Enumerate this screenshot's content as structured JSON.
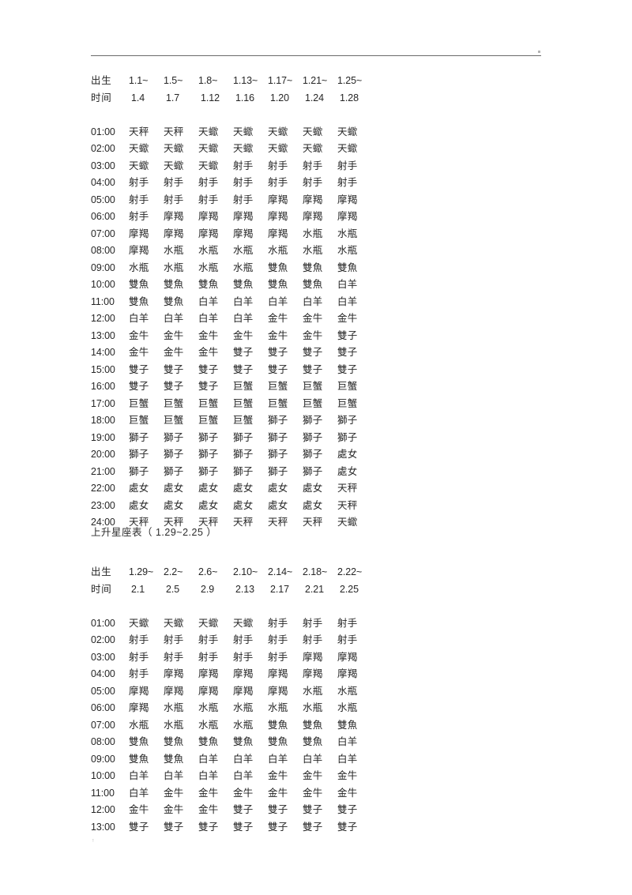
{
  "document": {
    "header_rule": true,
    "footer_mark": "፧"
  },
  "section1": {
    "date_label_start": "出生",
    "date_label_end": "时间",
    "dates_start": [
      "1.1~",
      "1.5~",
      "1.8~",
      "1.13~",
      "1.17~",
      "1.21~",
      "1.25~"
    ],
    "dates_end": [
      "1.4",
      "1.7",
      "1.12",
      "1.16",
      "1.20",
      "1.24",
      "1.28"
    ],
    "rows": [
      {
        "time": "01:00",
        "signs": [
          "天秤",
          "天秤",
          "天蠍",
          "天蠍",
          "天蠍",
          "天蠍",
          "天蠍"
        ]
      },
      {
        "time": "02:00",
        "signs": [
          "天蠍",
          "天蠍",
          "天蠍",
          "天蠍",
          "天蠍",
          "天蠍",
          "天蠍"
        ]
      },
      {
        "time": "03:00",
        "signs": [
          "天蠍",
          "天蠍",
          "天蠍",
          "射手",
          "射手",
          "射手",
          "射手"
        ]
      },
      {
        "time": "04:00",
        "signs": [
          "射手",
          "射手",
          "射手",
          "射手",
          "射手",
          "射手",
          "射手"
        ]
      },
      {
        "time": "05:00",
        "signs": [
          "射手",
          "射手",
          "射手",
          "射手",
          "摩羯",
          "摩羯",
          "摩羯"
        ]
      },
      {
        "time": "06:00",
        "signs": [
          "射手",
          "摩羯",
          "摩羯",
          "摩羯",
          "摩羯",
          "摩羯",
          "摩羯"
        ]
      },
      {
        "time": "07:00",
        "signs": [
          "摩羯",
          "摩羯",
          "摩羯",
          "摩羯",
          "摩羯",
          "水瓶",
          "水瓶"
        ]
      },
      {
        "time": "08:00",
        "signs": [
          "摩羯",
          "水瓶",
          "水瓶",
          "水瓶",
          "水瓶",
          "水瓶",
          "水瓶"
        ]
      },
      {
        "time": "09:00",
        "signs": [
          "水瓶",
          "水瓶",
          "水瓶",
          "水瓶",
          "雙魚",
          "雙魚",
          "雙魚"
        ]
      },
      {
        "time": "10:00",
        "signs": [
          "雙魚",
          "雙魚",
          "雙魚",
          "雙魚",
          "雙魚",
          "雙魚",
          "白羊"
        ]
      },
      {
        "time": "11:00",
        "signs": [
          "雙魚",
          "雙魚",
          "白羊",
          "白羊",
          "白羊",
          "白羊",
          "白羊"
        ]
      },
      {
        "time": "12:00",
        "signs": [
          "白羊",
          "白羊",
          "白羊",
          "白羊",
          "金牛",
          "金牛",
          "金牛"
        ]
      },
      {
        "time": "13:00",
        "signs": [
          "金牛",
          "金牛",
          "金牛",
          "金牛",
          "金牛",
          "金牛",
          "雙子"
        ]
      },
      {
        "time": "14:00",
        "signs": [
          "金牛",
          "金牛",
          "金牛",
          "雙子",
          "雙子",
          "雙子",
          "雙子"
        ]
      },
      {
        "time": "15:00",
        "signs": [
          "雙子",
          "雙子",
          "雙子",
          "雙子",
          "雙子",
          "雙子",
          "雙子"
        ]
      },
      {
        "time": "16:00",
        "signs": [
          "雙子",
          "雙子",
          "雙子",
          "巨蟹",
          "巨蟹",
          "巨蟹",
          "巨蟹"
        ]
      },
      {
        "time": "17:00",
        "signs": [
          "巨蟹",
          "巨蟹",
          "巨蟹",
          "巨蟹",
          "巨蟹",
          "巨蟹",
          "巨蟹"
        ]
      },
      {
        "time": "18:00",
        "signs": [
          "巨蟹",
          "巨蟹",
          "巨蟹",
          "巨蟹",
          "獅子",
          "獅子",
          "獅子"
        ]
      },
      {
        "time": "19:00",
        "signs": [
          "獅子",
          "獅子",
          "獅子",
          "獅子",
          "獅子",
          "獅子",
          "獅子"
        ]
      },
      {
        "time": "20:00",
        "signs": [
          "獅子",
          "獅子",
          "獅子",
          "獅子",
          "獅子",
          "獅子",
          "處女"
        ]
      },
      {
        "time": "21:00",
        "signs": [
          "獅子",
          "獅子",
          "獅子",
          "獅子",
          "獅子",
          "獅子",
          "處女"
        ]
      },
      {
        "time": "22:00",
        "signs": [
          "處女",
          "處女",
          "處女",
          "處女",
          "處女",
          "處女",
          "天秤"
        ]
      },
      {
        "time": "23:00",
        "signs": [
          "處女",
          "處女",
          "處女",
          "處女",
          "處女",
          "處女",
          "天秤"
        ]
      },
      {
        "time": "24:00",
        "signs": [
          "天秤",
          "天秤",
          "天秤",
          "天秤",
          "天秤",
          "天秤",
          "天蠍"
        ]
      }
    ]
  },
  "section2": {
    "title": "上升星座表（ 1.29~2.25 ）",
    "date_label_start": "出生",
    "date_label_end": "时间",
    "dates_start": [
      "1.29~",
      "2.2~",
      "2.6~",
      "2.10~",
      "2.14~",
      "2.18~",
      "2.22~"
    ],
    "dates_end": [
      "2.1",
      "2.5",
      "2.9",
      "2.13",
      "2.17",
      "2.21",
      "2.25"
    ],
    "rows": [
      {
        "time": "01:00",
        "signs": [
          "天蠍",
          "天蠍",
          "天蠍",
          "天蠍",
          "射手",
          "射手",
          "射手"
        ]
      },
      {
        "time": "02:00",
        "signs": [
          "射手",
          "射手",
          "射手",
          "射手",
          "射手",
          "射手",
          "射手"
        ]
      },
      {
        "time": "03:00",
        "signs": [
          "射手",
          "射手",
          "射手",
          "射手",
          "射手",
          "摩羯",
          "摩羯"
        ]
      },
      {
        "time": "04:00",
        "signs": [
          "射手",
          "摩羯",
          "摩羯",
          "摩羯",
          "摩羯",
          "摩羯",
          "摩羯"
        ]
      },
      {
        "time": "05:00",
        "signs": [
          "摩羯",
          "摩羯",
          "摩羯",
          "摩羯",
          "摩羯",
          "水瓶",
          "水瓶"
        ]
      },
      {
        "time": "06:00",
        "signs": [
          "摩羯",
          "水瓶",
          "水瓶",
          "水瓶",
          "水瓶",
          "水瓶",
          "水瓶"
        ]
      },
      {
        "time": "07:00",
        "signs": [
          "水瓶",
          "水瓶",
          "水瓶",
          "水瓶",
          "雙魚",
          "雙魚",
          "雙魚"
        ]
      },
      {
        "time": "08:00",
        "signs": [
          "雙魚",
          "雙魚",
          "雙魚",
          "雙魚",
          "雙魚",
          "雙魚",
          "白羊"
        ]
      },
      {
        "time": "09:00",
        "signs": [
          "雙魚",
          "雙魚",
          "白羊",
          "白羊",
          "白羊",
          "白羊",
          "白羊"
        ]
      },
      {
        "time": "10:00",
        "signs": [
          "白羊",
          "白羊",
          "白羊",
          "白羊",
          "金牛",
          "金牛",
          "金牛"
        ]
      },
      {
        "time": "11:00",
        "signs": [
          "白羊",
          "金牛",
          "金牛",
          "金牛",
          "金牛",
          "金牛",
          "金牛"
        ]
      },
      {
        "time": "12:00",
        "signs": [
          "金牛",
          "金牛",
          "金牛",
          "雙子",
          "雙子",
          "雙子",
          "雙子"
        ]
      },
      {
        "time": "13:00",
        "signs": [
          "雙子",
          "雙子",
          "雙子",
          "雙子",
          "雙子",
          "雙子",
          "雙子"
        ]
      }
    ]
  }
}
